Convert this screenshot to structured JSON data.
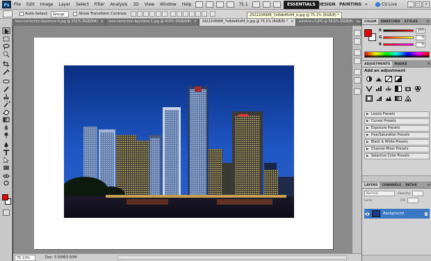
{
  "menubar": {
    "logo": "Ps",
    "items": [
      "File",
      "Edit",
      "Image",
      "Layer",
      "Select",
      "Filter",
      "Analysis",
      "3D",
      "View",
      "Window",
      "Help"
    ],
    "zoom": "75.1"
  },
  "workspaces": {
    "essentials": "ESSENTIALS",
    "design": "DESIGN",
    "painting": "PAINTING",
    "cs_live": "CS Live"
  },
  "options": {
    "auto_select_label": "Auto-Select:",
    "auto_select_value": "Group",
    "transform_label": "Show Transform Controls"
  },
  "tooltip_filename": "2922208988_7e8db45df4_b.jpg @ 75.1% (RGB/8) *",
  "doc_tabs": [
    "lens-correction-keystone-4.jpg @ 251% (RGB/8#)",
    "lens-correction-keystone-1.jpg @ 429% (RGB/8#)",
    "2922208988_7e8db45df4_b.jpg @ 75.1% (RGB/8) *",
    "window+3.JPG @ 56.6% (RGB/8)"
  ],
  "status": {
    "zoom": "75.13%",
    "doc": "Doc: 3.50M/3.50M"
  },
  "color_panel": {
    "tabs": [
      "COLOR",
      "SWATCHES",
      "STYLES"
    ],
    "sliders": [
      {
        "label": "R",
        "value": "255"
      },
      {
        "label": "G",
        "value": "0"
      },
      {
        "label": "B",
        "value": "0"
      }
    ],
    "fg_color": "#e30000"
  },
  "adjustments": {
    "tabs": [
      "ADJUSTMENTS",
      "MASKS"
    ],
    "title": "Add an adjustment",
    "presets": [
      "Levels Presets",
      "Curves Presets",
      "Exposure Presets",
      "Hue/Saturation Presets",
      "Black & White Presets",
      "Channel Mixer Presets",
      "Selective Color Presets"
    ]
  },
  "layers": {
    "tabs": [
      "LAYERS",
      "CHANNELS",
      "PATHS"
    ],
    "blend_mode": "Normal",
    "opacity_label": "Opacity:",
    "lock_label": "Lock:",
    "fill_label": "Fill:",
    "layer_name": "Background",
    "selected_color": "#3b78c4"
  },
  "icons": {
    "toolbox": [
      "move-icon",
      "marquee-icon",
      "lasso-icon",
      "quick-select-icon",
      "crop-icon",
      "eyedropper-icon",
      "healing-brush-icon",
      "brush-icon",
      "clone-stamp-icon",
      "history-brush-icon",
      "eraser-icon",
      "gradient-icon",
      "blur-icon",
      "dodge-icon",
      "pen-icon",
      "type-icon",
      "path-select-icon",
      "shape-icon",
      "3d-rotate-icon",
      "3d-orbit-icon",
      "hand-icon",
      "zoom-icon"
    ]
  }
}
